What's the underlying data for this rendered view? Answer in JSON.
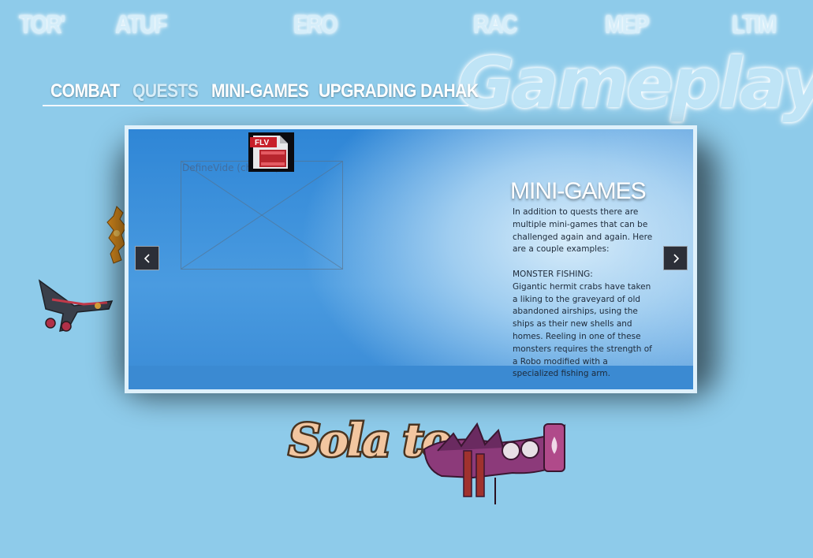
{
  "top_nav": [
    {
      "label": "TOR'"
    },
    {
      "label": "ATUF"
    },
    {
      "label": "ERO"
    },
    {
      "label": "RAC"
    },
    {
      "label": "MEP"
    },
    {
      "label": "LTIM"
    }
  ],
  "page_title": "Gameplay",
  "tabs": [
    {
      "label": "COMBAT",
      "active": false
    },
    {
      "label": "QUESTS",
      "active": false
    },
    {
      "label": "MINI-GAMES",
      "active": true
    },
    {
      "label": "UPGRADING DAHAK",
      "active": false
    }
  ],
  "panel": {
    "video_placeholder_label": "DefineVide              (chid 19)",
    "flv_icon": {
      "label": "FLV",
      "icon": "flv-file-icon"
    },
    "section_title": "MINI-GAMES",
    "intro": "In addition to quests there are multiple mini-games that can be challenged again and again. Here are a couple examples:",
    "subheading": "MONSTER FISHING:",
    "body": "Gigantic hermit crabs have taken a liking to the graveyard of old abandoned airships, using the ships as their new shells and homes. Reeling in one of these monsters requires the strength of a Robo modified with a specialized fishing arm.",
    "prev_icon": "chevron-left-icon",
    "next_icon": "chevron-right-icon"
  },
  "logo": {
    "text": "Sola to"
  },
  "colors": {
    "background": "#8ecbea",
    "panel_blue": "#3a8fd8",
    "panel_border": "#dff1fb",
    "arrow_button": "#2c2f38"
  }
}
